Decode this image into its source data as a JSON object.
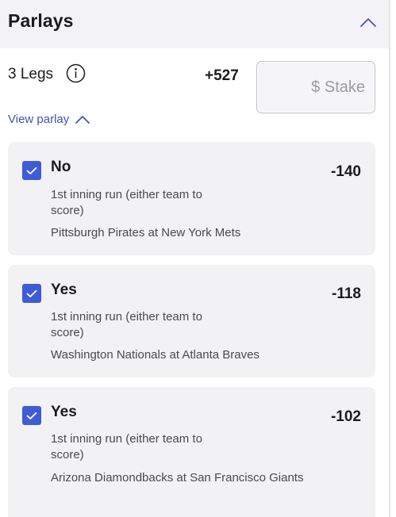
{
  "header": {
    "title": "Parlays",
    "collapse_icon": "chevron-up-icon"
  },
  "summary": {
    "legs_label": "3 Legs",
    "info_icon": "info-icon",
    "total_odds": "+527",
    "stake_placeholder": "$ Stake",
    "stake_value": "",
    "view_parlay_label": "View parlay"
  },
  "legs": [
    {
      "checked": true,
      "selection": "No",
      "market": "1st inning run (either team to score)",
      "game": "Pittsburgh Pirates at New York Mets",
      "odds": "-140"
    },
    {
      "checked": true,
      "selection": "Yes",
      "market": "1st inning run (either team to score)",
      "game": "Washington Nationals at Atlanta Braves",
      "odds": "-118"
    },
    {
      "checked": true,
      "selection": "Yes",
      "market": "1st inning run (either team to score)",
      "game": "Arizona Diamondbacks at San Francisco Giants",
      "odds": "-102"
    }
  ],
  "colors": {
    "accent": "#3f5bd6",
    "link": "#3d55b8",
    "card_bg": "#f2f2f5",
    "header_bg": "#f3f3f6"
  }
}
